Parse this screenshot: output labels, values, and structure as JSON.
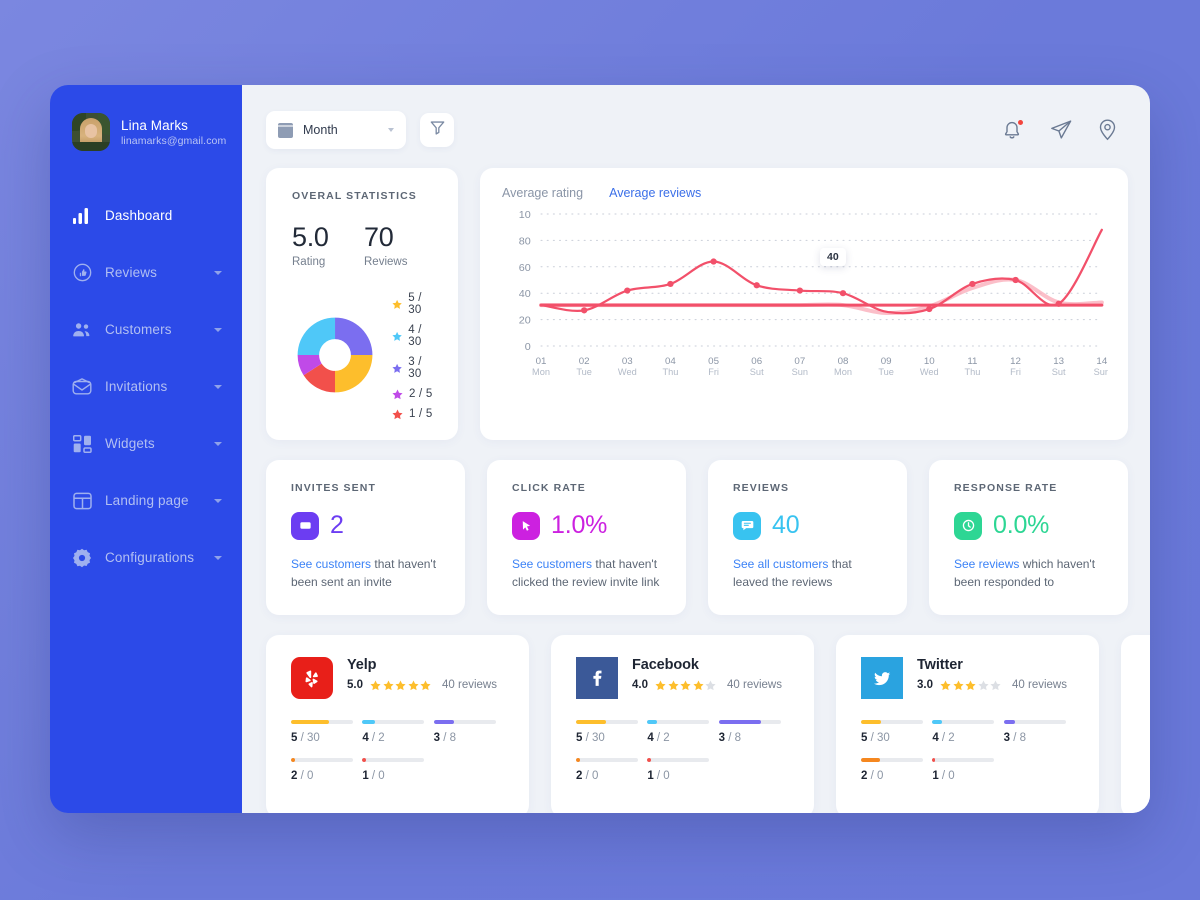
{
  "sidebar": {
    "profile": {
      "name": "Lina Marks",
      "email": "linamarks@gmail.com",
      "avatar_icon": "user-avatar"
    },
    "items": [
      {
        "label": "Dashboard",
        "icon": "bar-chart-icon",
        "active": true,
        "caret": false
      },
      {
        "label": "Reviews",
        "icon": "thumbs-up-icon",
        "active": false,
        "caret": true
      },
      {
        "label": "Customers",
        "icon": "users-icon",
        "active": false,
        "caret": true
      },
      {
        "label": "Invitations",
        "icon": "envelope-icon",
        "active": false,
        "caret": true
      },
      {
        "label": "Widgets",
        "icon": "widgets-icon",
        "active": false,
        "caret": true
      },
      {
        "label": "Landing page",
        "icon": "browser-icon",
        "active": false,
        "caret": true
      },
      {
        "label": "Configurations",
        "icon": "gear-icon",
        "active": false,
        "caret": true
      }
    ]
  },
  "topbar": {
    "period_label": "Month",
    "calendar_icon": "calendar-icon",
    "filter_icon": "filter-icon",
    "icons": [
      {
        "name": "notification-bell-icon",
        "badge": true
      },
      {
        "name": "send-icon",
        "badge": false
      },
      {
        "name": "location-pin-icon",
        "badge": false
      }
    ]
  },
  "stats": {
    "title": "OVERAL STATISTICS",
    "rating_value": "5.0",
    "rating_label": "Rating",
    "reviews_value": "70",
    "reviews_label": "Reviews",
    "legend": [
      {
        "text": "5 / 30",
        "score": "5",
        "count": "30",
        "color": "#fdbe2c"
      },
      {
        "text": "4 / 30",
        "score": "4",
        "count": "30",
        "color": "#4fc8f8"
      },
      {
        "text": "3 / 30",
        "score": "3",
        "count": "30",
        "color": "#7b6ef0"
      },
      {
        "text": "2 / 5",
        "score": "2",
        "count": "5",
        "color": "#c04ae8"
      },
      {
        "text": "1 / 5",
        "score": "1",
        "count": "5",
        "color": "#f2504b"
      }
    ],
    "donut": [
      {
        "label": "5",
        "color": "#fdbe2c",
        "percent": 25
      },
      {
        "label": "4",
        "color": "#4fc8f8",
        "percent": 25
      },
      {
        "label": "3",
        "color": "#7b6ef0",
        "percent": 25
      },
      {
        "label": "2",
        "color": "#c04ae8",
        "percent": 12
      },
      {
        "label": "1",
        "color": "#f2504b",
        "percent": 13
      }
    ]
  },
  "chart_data": {
    "type": "line",
    "title": "",
    "tabs": [
      {
        "label": "Average rating",
        "active": false
      },
      {
        "label": "Average reviews",
        "active": true
      }
    ],
    "xlabel": "",
    "ylabel": "",
    "ylim": [
      0,
      100
    ],
    "grid": "dotted",
    "legend_position": "top-left",
    "yticks": [
      "10",
      "80",
      "60",
      "40",
      "20",
      "0"
    ],
    "categories": [
      "01",
      "02",
      "03",
      "04",
      "05",
      "06",
      "07",
      "08",
      "09",
      "10",
      "11",
      "12",
      "13",
      "14"
    ],
    "category_sublabels": [
      "Mon",
      "Tue",
      "Wed",
      "Thu",
      "Fri",
      "Sut",
      "Sun",
      "Mon",
      "Tue",
      "Wed",
      "Thu",
      "Fri",
      "Sut",
      "Sun"
    ],
    "series": [
      {
        "name": "Average reviews",
        "color": "#f2506a",
        "values": [
          31,
          27,
          42,
          47,
          64,
          46,
          42,
          40,
          26,
          28,
          47,
          50,
          32,
          88
        ],
        "markers": [
          false,
          true,
          true,
          true,
          true,
          true,
          true,
          true,
          false,
          true,
          true,
          true,
          true,
          false
        ]
      },
      {
        "name": "Average rating",
        "color": "#f9aab7",
        "values": [
          31,
          31,
          31,
          31,
          31,
          31,
          31,
          31,
          25,
          30,
          44,
          50,
          33,
          33
        ]
      }
    ],
    "annotation": {
      "label": "40",
      "at_category": "08",
      "value": 40
    }
  },
  "kpis": [
    {
      "title": "INVITES SENT",
      "value": "2",
      "icon": "envelope-square-icon",
      "icon_bg": "#6c3df2",
      "value_color": "#6c3df2",
      "link_text": "See customers",
      "desc_text": " that haven't been sent an invite"
    },
    {
      "title": "CLICK RATE",
      "value": "1.0%",
      "icon": "cursor-click-icon",
      "icon_bg": "#cc21e0",
      "value_color": "#cc21e0",
      "link_text": "See customers",
      "desc_text": " that haven't clicked the review invite link"
    },
    {
      "title": "REVIEWS",
      "value": "40",
      "icon": "chat-bubble-icon",
      "icon_bg": "#38c3f0",
      "value_color": "#38c3f0",
      "link_text": "See all customers",
      "desc_text": " that leaved the reviews"
    },
    {
      "title": "RESPONSE RATE",
      "value": "0.0%",
      "icon": "clock-icon",
      "icon_bg": "#2dd694",
      "value_color": "#2dd694",
      "link_text": "See reviews",
      "desc_text": " which haven't been responded to"
    }
  ],
  "platforms": [
    {
      "name": "Yelp",
      "logo_icon": "yelp-logo-icon",
      "logo_bg": "#e81f19",
      "rating": "5.0",
      "stars_filled": 5,
      "reviews_text": "40 reviews",
      "bars": [
        {
          "label_score": "5",
          "label_count": "30",
          "color": "#fdbe2c",
          "fill_percent": 62
        },
        {
          "label_score": "4",
          "label_count": "2",
          "color": "#4fc8f8",
          "fill_percent": 20
        },
        {
          "label_score": "3",
          "label_count": "8",
          "color": "#7b6ef0",
          "fill_percent": 33
        },
        {
          "label_score": "2",
          "label_count": "0",
          "color": "#f5871f",
          "fill_percent": 6
        },
        {
          "label_score": "1",
          "label_count": "0",
          "color": "#f2504b",
          "fill_percent": 6
        }
      ]
    },
    {
      "name": "Facebook",
      "logo_icon": "facebook-logo-icon",
      "logo_bg": "#3b5998",
      "rating": "4.0",
      "stars_filled": 4,
      "reviews_text": "40 reviews",
      "bars": [
        {
          "label_score": "5",
          "label_count": "30",
          "color": "#fdbe2c",
          "fill_percent": 48
        },
        {
          "label_score": "4",
          "label_count": "2",
          "color": "#4fc8f8",
          "fill_percent": 16
        },
        {
          "label_score": "3",
          "label_count": "8",
          "color": "#7b6ef0",
          "fill_percent": 68
        },
        {
          "label_score": "2",
          "label_count": "0",
          "color": "#f5871f",
          "fill_percent": 6
        },
        {
          "label_score": "1",
          "label_count": "0",
          "color": "#f2504b",
          "fill_percent": 6
        }
      ]
    },
    {
      "name": "Twitter",
      "logo_icon": "twitter-logo-icon",
      "logo_bg": "#2aa3e0",
      "rating": "3.0",
      "stars_filled": 3,
      "reviews_text": "40 reviews",
      "bars": [
        {
          "label_score": "5",
          "label_count": "30",
          "color": "#fdbe2c",
          "fill_percent": 33
        },
        {
          "label_score": "4",
          "label_count": "2",
          "color": "#4fc8f8",
          "fill_percent": 16
        },
        {
          "label_score": "3",
          "label_count": "8",
          "color": "#7b6ef0",
          "fill_percent": 18
        },
        {
          "label_score": "2",
          "label_count": "0",
          "color": "#f5871f",
          "fill_percent": 30
        },
        {
          "label_score": "1",
          "label_count": "0",
          "color": "#f2504b",
          "fill_percent": 5
        }
      ]
    }
  ],
  "colors": {
    "sidebar_bg": "#2c4ae8",
    "page_bg": "#6b7ada",
    "main_bg": "#eff2f7",
    "accent_link": "#3b82f6",
    "chart_line": "#f2506a"
  }
}
